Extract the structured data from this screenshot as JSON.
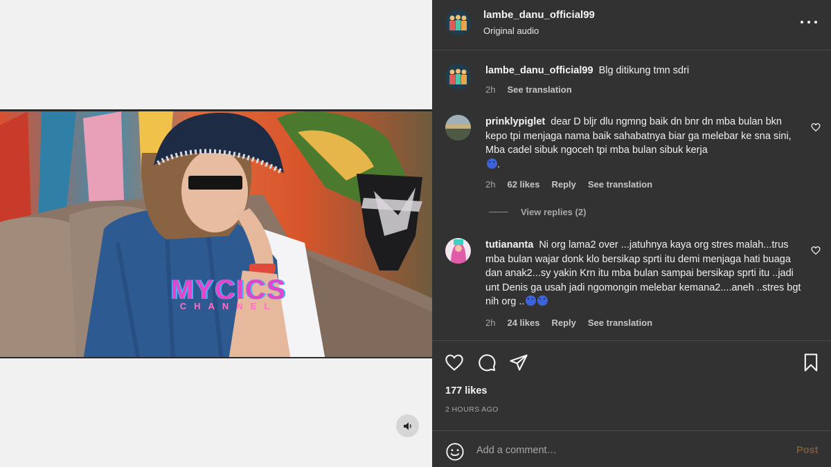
{
  "post": {
    "username": "lambe_danu_official99",
    "audio": "Original audio"
  },
  "video": {
    "watermark_main": "MYCICS",
    "watermark_sub": "CHANNEL"
  },
  "caption": {
    "username": "lambe_danu_official99",
    "text": "Blg ditikung tmn sdri",
    "time": "2h",
    "translate": "See translation"
  },
  "comments": [
    {
      "username": "prinklypiglet",
      "text": "dear D bljr dlu ngmng baik dn bnr dn mba bulan bkn kepo tpi menjaga nama baik sahabatnya biar ga melebar ke sna sini, Mba cadel sibuk ngoceh tpi mba bulan sibuk kerja",
      "trail": ".",
      "time": "2h",
      "likes": "62 likes",
      "reply": "Reply",
      "translate": "See translation",
      "view_replies": "View replies (2)"
    },
    {
      "username": "tutiananta",
      "text": "Ni org lama2 over ...jatuhnya kaya org stres malah...trus mba bulan wajar donk klo bersikap sprti itu demi menjaga hati buaga dan anak2...sy yakin Krn itu mba bulan sampai bersikap sprti itu ..jadi unt Denis ga usah jadi ngomongin melebar kemana2....aneh ..stres bgt nih org ..",
      "time": "2h",
      "likes": "24 likes",
      "reply": "Reply",
      "translate": "See translation"
    }
  ],
  "stats": {
    "likes": "177 likes",
    "time_ago": "2 HOURS AGO"
  },
  "composer": {
    "placeholder": "Add a comment…",
    "post_label": "Post"
  },
  "colors": {
    "panel_bg": "#323232",
    "post_button": "#7a5a3e"
  }
}
